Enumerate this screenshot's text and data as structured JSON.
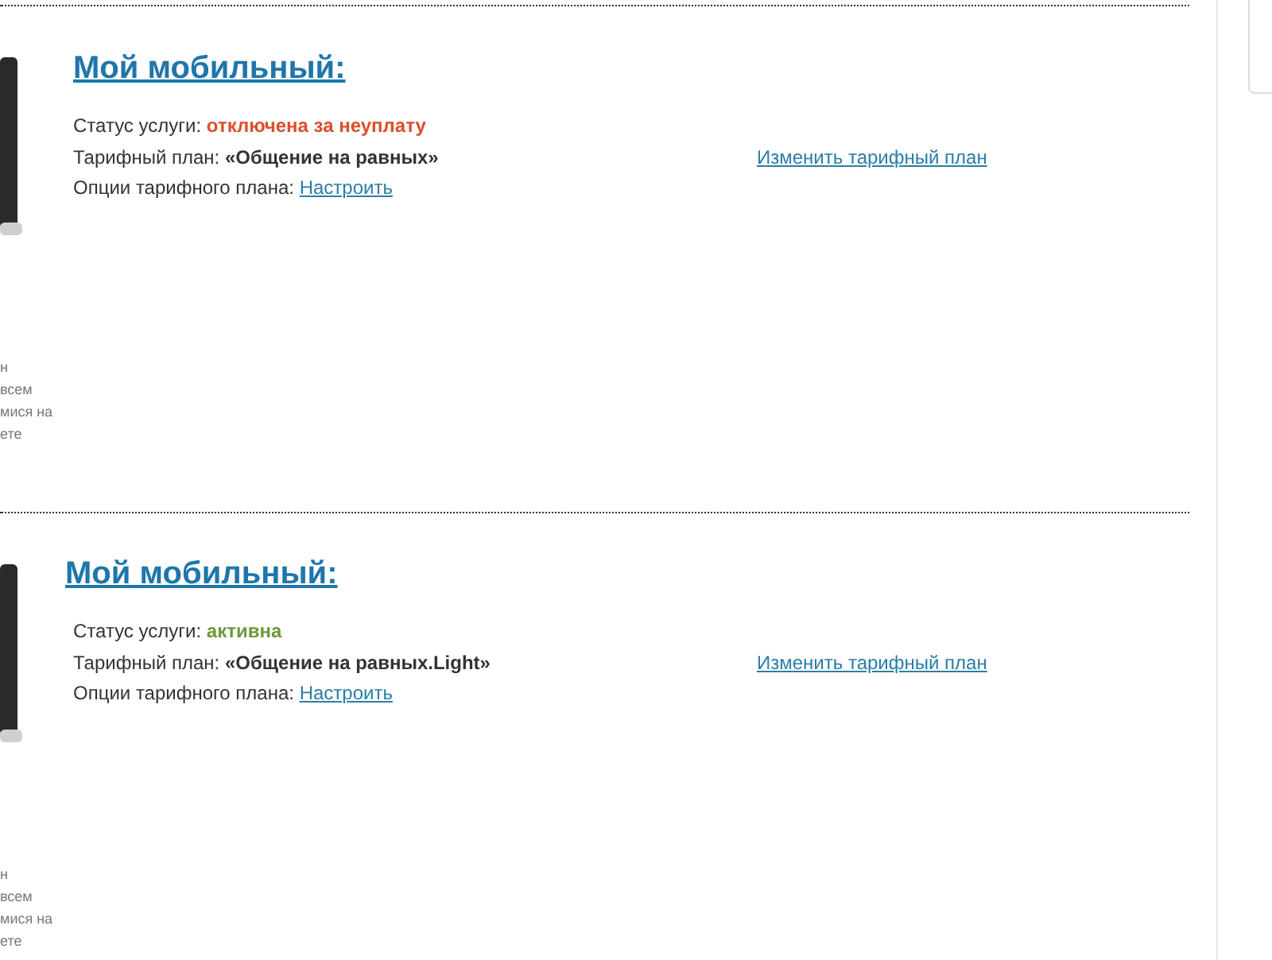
{
  "services": [
    {
      "title": "Мой мобильный:",
      "status_label": "Статус услуги:",
      "status": {
        "kind": "disconnected",
        "text": "отключена за неуплату"
      },
      "plan_label": "Тарифный план:",
      "plan": "«Общение на равных»",
      "options_label": "Опции тарифного плана:",
      "options_link": "Настроить",
      "change_link": "Изменить тарифный план",
      "side_note": [
        "н",
        "всем",
        "мися на",
        "ете"
      ]
    },
    {
      "title": "Мой мобильный:",
      "status_label": "Статус услуги:",
      "status": {
        "kind": "active",
        "text": "активна"
      },
      "plan_label": "Тарифный план:",
      "plan": "«Общение на равных.Light»",
      "options_label": "Опции тарифного плана:",
      "options_link": "Настроить",
      "change_link": "Изменить тарифный план",
      "side_note": [
        "н",
        "всем",
        "мися на",
        "ете"
      ]
    }
  ]
}
